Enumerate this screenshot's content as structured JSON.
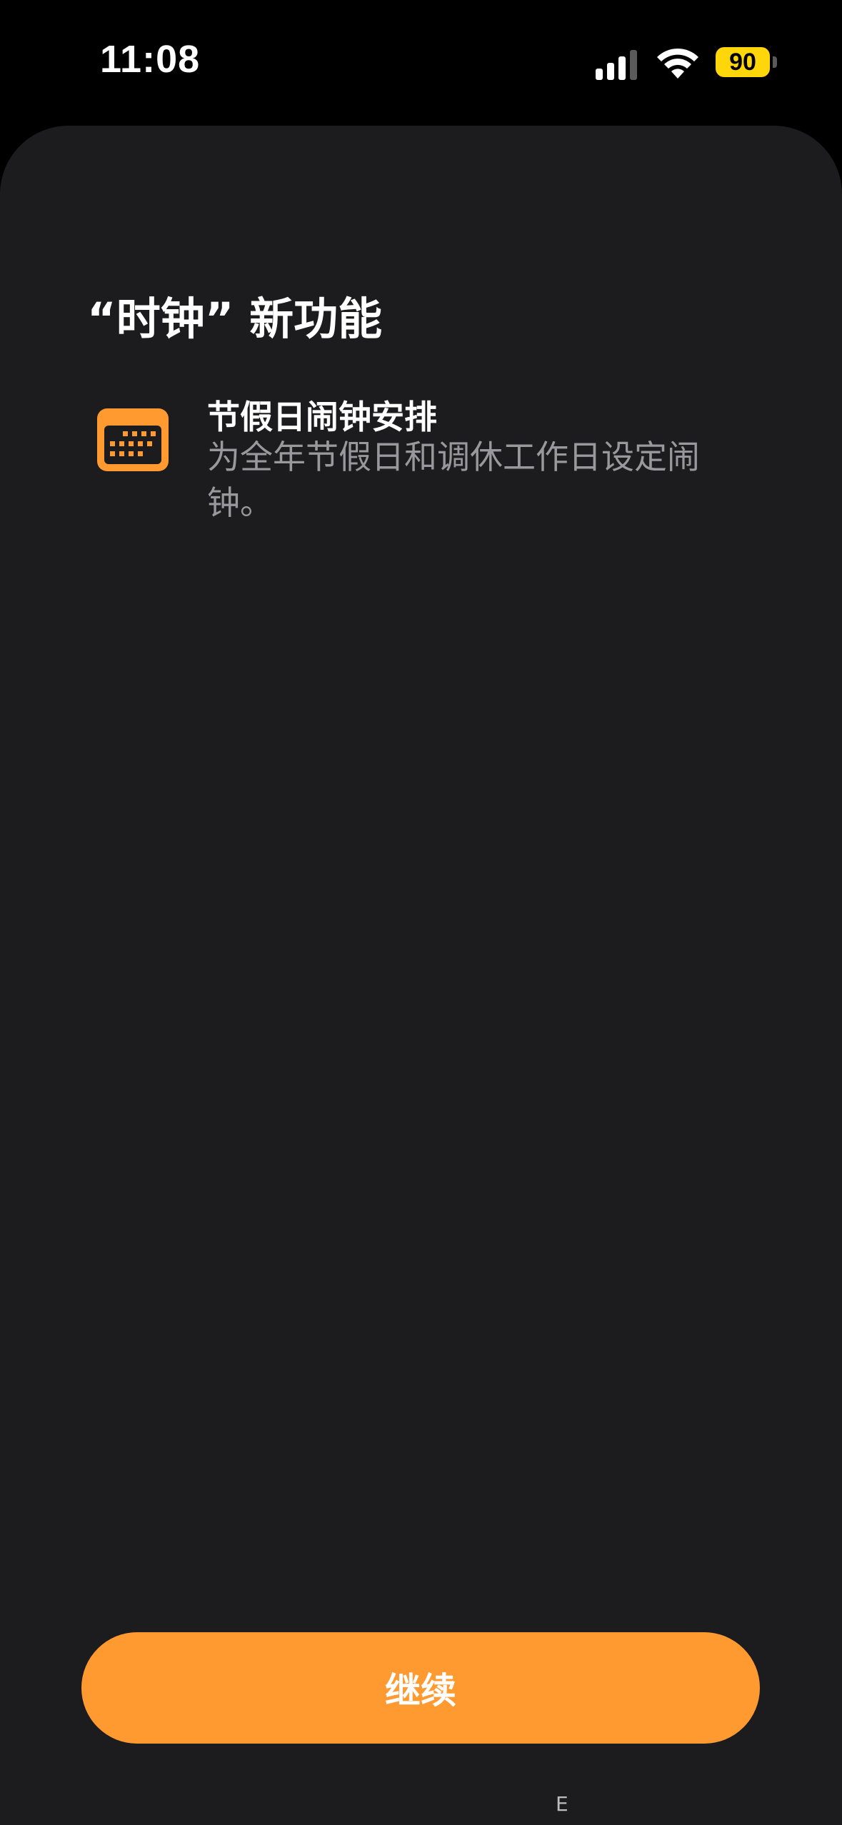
{
  "status_bar": {
    "time": "11:08",
    "signal_icon": "cellular-signal-icon",
    "wifi_icon": "wifi-icon",
    "battery_level": "90",
    "battery_color": "#ffd60a"
  },
  "sheet": {
    "title": "“时钟” 新功能",
    "feature": {
      "icon": "calendar-icon",
      "icon_color": "#ff9a30",
      "title": "节假日闹钟安排",
      "description": "为全年节假日和调休工作日设定闹钟。"
    },
    "continue_label": "继续",
    "accent_color": "#ff9a30"
  },
  "bottom_text": "E"
}
